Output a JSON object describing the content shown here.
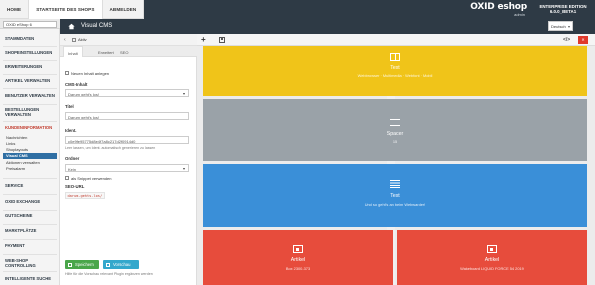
{
  "topnav": {
    "tabs": [
      {
        "label": "HOME",
        "active": false
      },
      {
        "label": "STARTSEITE DES SHOPS",
        "active": true
      },
      {
        "label": "ABMELDEN",
        "active": false
      }
    ]
  },
  "brand": {
    "logo_text": "OXID eshop",
    "logo_sub": "admin",
    "edition_line1": "ENTERPRISE EDITION",
    "edition_line2": "6.0.0_BETA1"
  },
  "shop_select": {
    "value": "OXID eShop 6"
  },
  "header": {
    "title": "Visual CMS",
    "home_icon": "home-icon",
    "language": "Deutsch"
  },
  "leftnav": {
    "items": [
      {
        "label": "STAMMDATEN"
      },
      {
        "label": "SHOPEINSTELLUNGEN"
      },
      {
        "label": "ERWEITERUNGEN"
      },
      {
        "label": "ARTIKEL VERWALTEN"
      },
      {
        "label": "BENUTZER VERWALTEN"
      },
      {
        "label": "BESTELLUNGEN VERWALTEN"
      },
      {
        "label": "KUNDENINFORMATION"
      },
      {
        "label": "SERVICE"
      },
      {
        "label": "OXID EXCHANGE"
      },
      {
        "label": "GUTSCHEINE"
      },
      {
        "label": "MARKTPLÄTZE"
      },
      {
        "label": "PAYMENT"
      },
      {
        "label": "WEB-SHOP CONTROLLING"
      },
      {
        "label": "INTELLIGENTE SUCHE"
      }
    ],
    "subitems": [
      {
        "label": "Nachrichten"
      },
      {
        "label": "Links"
      },
      {
        "label": "Shoplayouts"
      },
      {
        "label": "Visual CMS"
      },
      {
        "label": "Aktionen verwalten"
      },
      {
        "label": "Preisalarm"
      }
    ]
  },
  "form": {
    "aktiv_label": "Aktiv",
    "tabs": [
      "Inhalt",
      "Erweitert",
      "SEO"
    ],
    "cb_new_label": "Neuen Inhalt anlegen",
    "cms_label": "CMS-Inhalt",
    "cms_value": "Darum geht's los!",
    "title_label": "Titel",
    "title_value": "Darum geht's los!",
    "ident_label": "Ident.",
    "ident_value": "c0e9fe95775d8e4f7a8c217d2f0914d0",
    "ident_hint": "Leer lassen, um Ident. automatisch generieren zu lassen",
    "folder_label": "Ordner",
    "folder_value": "Kein",
    "cb_snippet_label": "als Snippet verwenden",
    "seo_label": "SEO-URL",
    "seo_value": "darum-gehts-los/",
    "save_label": "Speichern",
    "preview_label": "Vorschau",
    "footer_hint": "Hilfe für die Vorschau relevant Plugin ergänzen werden"
  },
  "toolbar": {
    "add_icon": "plus-icon",
    "save_icon": "save-icon",
    "code_icon": "code-icon",
    "trash_icon": "trash-icon"
  },
  "blocks": [
    {
      "id": "text1",
      "title": "Text",
      "subtitle": "Webbrowser · Multimedia · Webfont · Mobil",
      "icon": "columns-icon",
      "color": "#f0c419"
    },
    {
      "id": "spacer",
      "title": "Spacer",
      "subtitle": "15",
      "icon": "spacer-icon",
      "color": "#9aa2a8"
    },
    {
      "id": "text2",
      "title": "Text",
      "subtitle": "Und so geht's an beim Webwarder!",
      "icon": "lines-icon",
      "color": "#3a8fd8"
    },
    {
      "id": "art1",
      "title": "Artikel",
      "subtitle": "Box 2300-373",
      "icon": "newspaper-icon",
      "color": "#e74c3c"
    },
    {
      "id": "art2",
      "title": "Artikel",
      "subtitle": "Wakeboard LIQUID FORCE 54 2019",
      "icon": "newspaper-icon",
      "color": "#e74c3c"
    }
  ]
}
